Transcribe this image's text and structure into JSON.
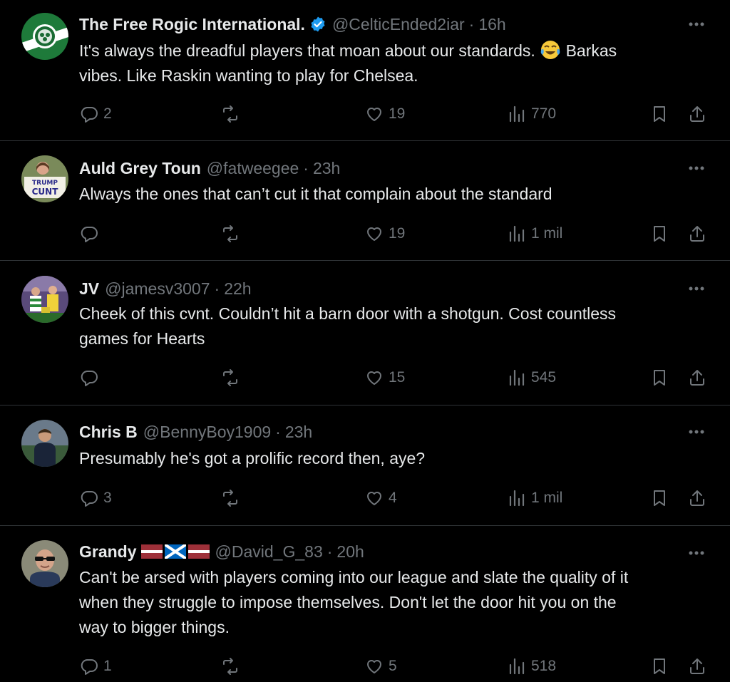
{
  "colors": {
    "background": "#000000",
    "divider": "#2f3336",
    "text_primary": "#e7e9ea",
    "text_secondary": "#71767b",
    "verified_blue": "#1d9bf0"
  },
  "tweets": [
    {
      "display_name": "The Free Rogic International.",
      "verified": true,
      "handle": "@CelticEnded2iar",
      "separator": "·",
      "time": "16h",
      "text_line_1": "It's always the dreadful players that moan about our standards.",
      "emoji": "face-with-tears-of-joy",
      "text_line_1_tail": "Barkas",
      "text_line_2": "vibes. Like Raskin wanting to play for Chelsea.",
      "replies": "2",
      "reposts": "",
      "likes": "19",
      "views": "770",
      "avatar": "celtic-crest-avatar"
    },
    {
      "display_name": "Auld Grey Toun",
      "handle": "@fatweegee",
      "separator": "·",
      "time": "23h",
      "text_line_1": "Always the ones that can’t cut it that complain about the standard",
      "replies": "",
      "reposts": "",
      "likes": "19",
      "views": "1 mil",
      "avatar": "protest-sign-avatar",
      "avatar_sign_text": "TRUMP CUNT"
    },
    {
      "display_name": "JV",
      "handle": "@jamesv3007",
      "separator": "·",
      "time": "22h",
      "text_line_1": "Cheek of this cvnt. Couldn’t hit a barn door with a shotgun. Cost countless",
      "text_line_2": "games for Hearts",
      "replies": "",
      "reposts": "",
      "likes": "15",
      "views": "545",
      "avatar": "football-players-avatar"
    },
    {
      "display_name": "Chris B",
      "handle": "@BennyBoy1909",
      "separator": "·",
      "time": "23h",
      "text_line_1": "Presumably he's got a prolific record then, aye?",
      "replies": "3",
      "reposts": "",
      "likes": "4",
      "views": "1 mil",
      "avatar": "man-photo-avatar"
    },
    {
      "display_name": "Grandy",
      "flags": [
        "latvia-flag",
        "scotland-flag",
        "latvia-flag"
      ],
      "handle": "@David_G_83",
      "separator": "·",
      "time": "20h",
      "text_line_1": "Can't be arsed with players coming into our league and slate the quality of it",
      "text_line_2": "when they struggle to impose themselves. Don't let the door hit you on the",
      "text_line_3": "way to bigger things.",
      "replies": "1",
      "reposts": "",
      "likes": "5",
      "views": "518",
      "avatar": "man-sunglasses-avatar"
    }
  ]
}
